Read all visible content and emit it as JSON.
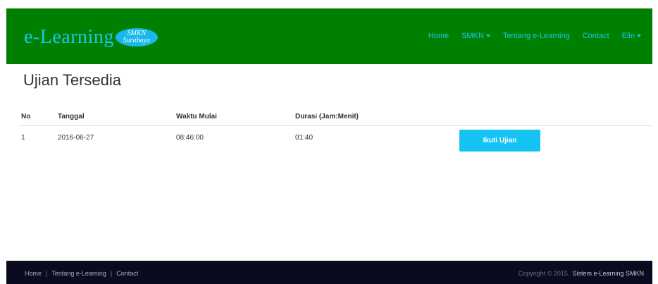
{
  "navbar": {
    "brand_text": "e-Learning",
    "badge_line1": "SMKN",
    "badge_line2": "Surabaya",
    "links": [
      "Home",
      "SMKN",
      "Tentang e-Learning",
      "Contact",
      "Elin"
    ],
    "bg_color": "#008000",
    "link_color": "#19c7ef"
  },
  "main": {
    "title": "Ujian Tersedia",
    "table": {
      "headers": [
        "No",
        "Tanggal",
        "Waktu Mulai",
        "Durasi (Jam:Menit)"
      ],
      "rows": [
        {
          "no": "1",
          "tanggal": "2016-06-27",
          "waktu_mulai": "08:46:00",
          "durasi": "01:40",
          "action_label": "Ikuti Ujian"
        }
      ]
    }
  },
  "footer": {
    "links": [
      "Home",
      "Tentang e-Learning",
      "Contact"
    ],
    "copyright": "Copyright © 2015.",
    "system_name": "Sistem e-Learning SMKN"
  }
}
